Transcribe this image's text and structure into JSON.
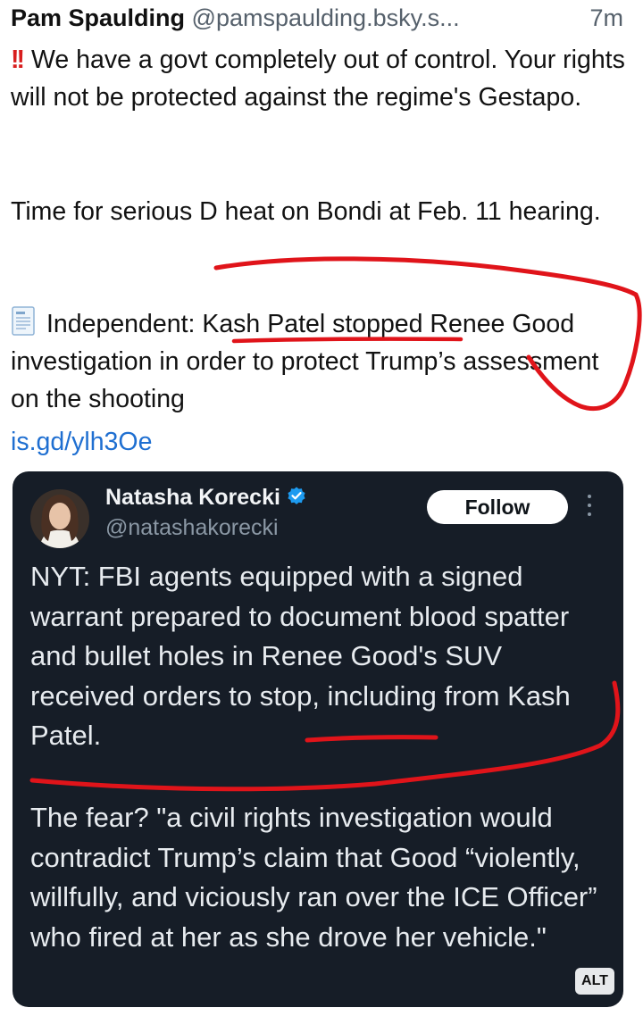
{
  "post": {
    "author_name": "Pam Spaulding",
    "author_handle": "@pamspaulding.bsky.s...",
    "timestamp": "7m",
    "text_line1": "We have a govt completely out of control. Your rights will not be protected against the regime's Gestapo.",
    "text_line2": "Time for serious D heat on Bondi at Feb. 11 hearing.",
    "text_line3": "Independent: Kash Patel stopped Renee Good investigation in order to protect Trump’s assessment on the shooting",
    "link": "is.gd/ylh3Oe",
    "icons": [
      "double-exclamation-icon",
      "document-icon"
    ]
  },
  "embedded_post": {
    "author_name": "Natasha Korecki",
    "author_handle": "@natashakorecki",
    "follow_label": "Follow",
    "paragraph1": "NYT: FBI agents equipped with a signed warrant prepared to document blood spatter and bullet holes in Renee Good's SUV received orders to stop, including from Kash Patel.",
    "paragraph2": "The fear? \"a civil rights investigation would contradict Trump’s claim that Good “violently, willfully, and viciously ran over the ICE Officer” who fired at her as she drove her vehicle.\"",
    "alt_badge": "ALT",
    "icons": [
      "avatar",
      "verified-badge-icon",
      "more-options-icon"
    ]
  },
  "colors": {
    "link": "#1f6fd1",
    "card_background": "#161d27",
    "annotation_red": "#e0141a",
    "verified_blue": "#1d9bf0"
  }
}
